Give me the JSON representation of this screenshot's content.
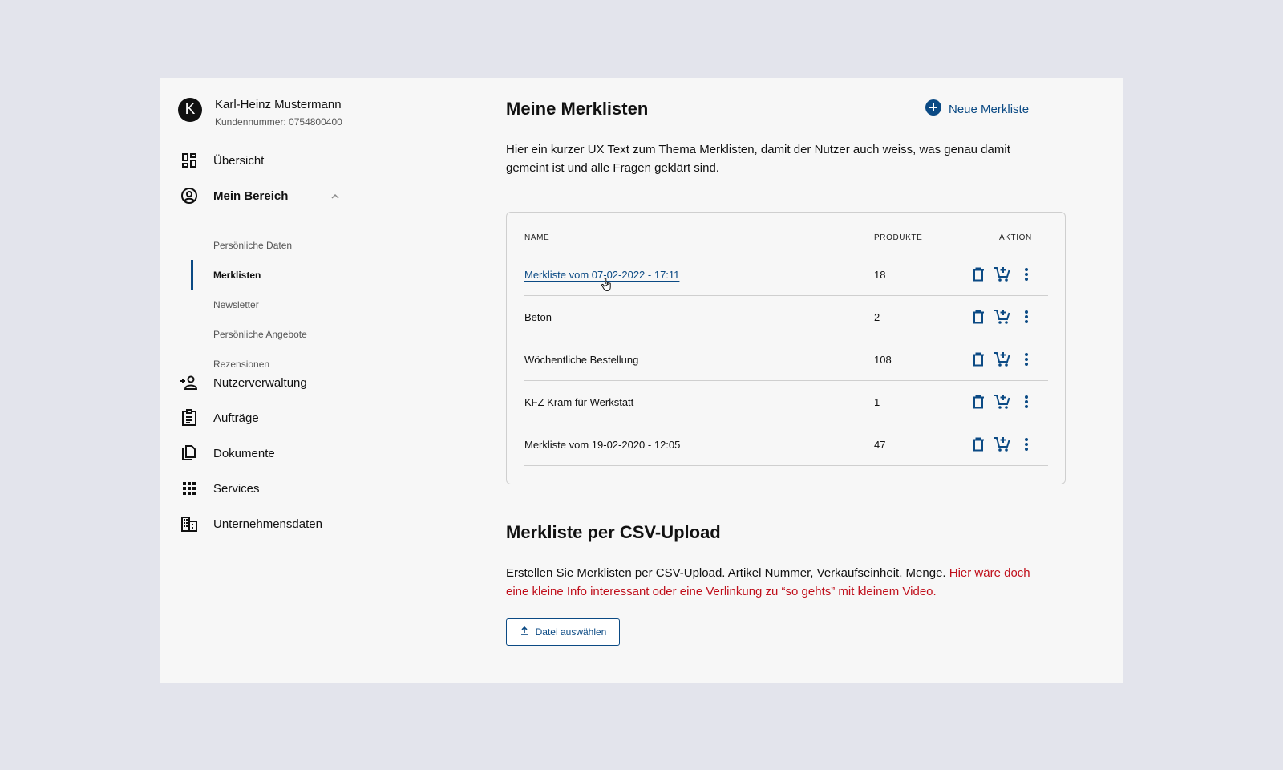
{
  "user": {
    "initial": "K",
    "name": "Karl-Heinz Mustermann",
    "customer_number": "Kundennummer: 0754800400"
  },
  "nav": {
    "overview": "Übersicht",
    "my_area": "Mein Bereich",
    "sub_items": [
      {
        "label": "Persönliche Daten",
        "active": false
      },
      {
        "label": "Merklisten",
        "active": true
      },
      {
        "label": "Newsletter",
        "active": false
      },
      {
        "label": "Persönliche Angebote",
        "active": false
      },
      {
        "label": "Rezensionen",
        "active": false
      }
    ],
    "user_management": "Nutzerverwaltung",
    "orders": "Aufträge",
    "documents": "Dokumente",
    "services": "Services",
    "company_data": "Unternehmensdaten"
  },
  "main": {
    "title": "Meine Merklisten",
    "new_list_label": "Neue Merkliste",
    "intro": "Hier ein kurzer UX Text zum Thema Merklisten, damit der Nutzer auch weiss, was genau damit gemeint ist und alle Fragen geklärt sind."
  },
  "table": {
    "columns": {
      "name": "NAME",
      "products": "PRODUKTE",
      "action": "AKTION"
    },
    "rows": [
      {
        "name": "Merkliste vom 07-02-2022 - 17:11",
        "products": "18",
        "hovered": true
      },
      {
        "name": "Beton",
        "products": "2",
        "hovered": false
      },
      {
        "name": "Wöchentliche Bestellung",
        "products": "108",
        "hovered": false
      },
      {
        "name": "KFZ Kram für Werkstatt",
        "products": "1",
        "hovered": false
      },
      {
        "name": "Merkliste vom 19-02-2020 - 12:05",
        "products": "47",
        "hovered": false
      }
    ]
  },
  "csv": {
    "title": "Merkliste per CSV-Upload",
    "text": "Erstellen Sie Merklisten per CSV-Upload. Artikel Nummer, Verkaufseinheit, Menge.",
    "hint": "Hier wäre doch eine kleine Info interessant oder eine Verlinkung zu “so gehts” mit kleinem Video.",
    "upload_label": "Datei auswählen"
  },
  "colors": {
    "accent": "#0b4a84",
    "hint": "#c0101c",
    "background": "#e3e4ec",
    "panel": "#f7f7f7"
  },
  "icons": [
    "dashboard-icon",
    "account-circle-icon",
    "chevron-up-icon",
    "person-add-icon",
    "clipboard-icon",
    "documents-icon",
    "apps-grid-icon",
    "building-icon",
    "add-circle-icon",
    "trash-icon",
    "add-to-cart-icon",
    "more-vertical-icon",
    "upload-icon",
    "hand-cursor-icon"
  ]
}
